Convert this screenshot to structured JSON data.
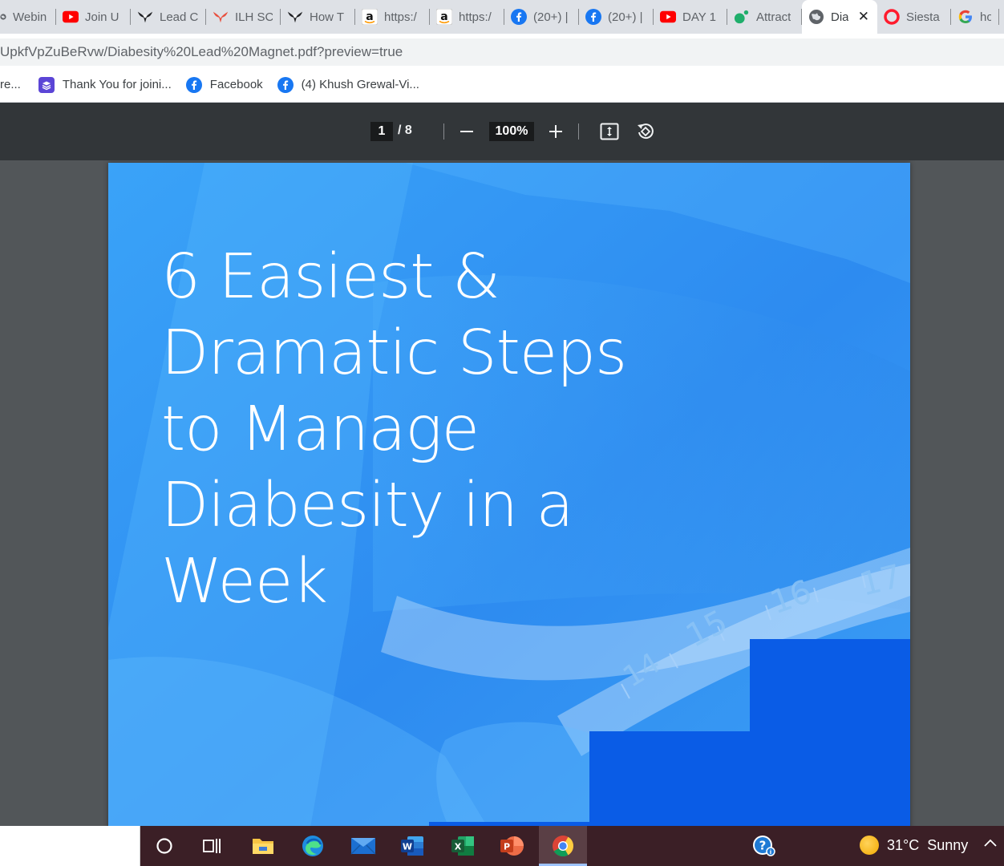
{
  "tabs": [
    {
      "title": "Webin",
      "icon": "globe-icon",
      "width": 70
    },
    {
      "title": "Join U",
      "icon": "youtube-icon",
      "width": 93
    },
    {
      "title": "Lead C",
      "icon": "eagle-icon",
      "width": 94
    },
    {
      "title": "ILH SC",
      "icon": "eagle-red-icon",
      "width": 93
    },
    {
      "title": "How T",
      "icon": "eagle-icon",
      "width": 93
    },
    {
      "title": "https:/",
      "icon": "amazon-icon",
      "width": 93
    },
    {
      "title": "https:/",
      "icon": "amazon-icon",
      "width": 93
    },
    {
      "title": "(20+) |",
      "icon": "facebook-icon",
      "width": 93
    },
    {
      "title": "(20+) |",
      "icon": "facebook-icon",
      "width": 93
    },
    {
      "title": "DAY 1",
      "icon": "youtube-icon",
      "width": 92
    },
    {
      "title": "Attract",
      "icon": "meet-icon",
      "width": 93
    },
    {
      "title": "Dia",
      "icon": "globe-icon",
      "width": 94,
      "active": true
    },
    {
      "title": "Siesta",
      "icon": "opera-icon",
      "width": 92
    },
    {
      "title": "how",
      "icon": "google-icon",
      "width": 60
    }
  ],
  "address": {
    "url": "UpkfVpZuBeRvw/Diabesity%20Lead%20Magnet.pdf?preview=true"
  },
  "bookmarks": [
    {
      "label": "re...",
      "icon": ""
    },
    {
      "label": "Thank You for joini...",
      "icon": "stack-icon"
    },
    {
      "label": "Facebook",
      "icon": "facebook-icon"
    },
    {
      "label": "(4) Khush Grewal-Vi...",
      "icon": "facebook-icon"
    }
  ],
  "pdf": {
    "current_page": "1",
    "page_separator": "/ 8",
    "zoom": "100%",
    "title_lines": [
      "6 Easiest &",
      "Dramatic Steps",
      "to Manage",
      "Diabesity in a",
      "Week"
    ],
    "tape_numbers": [
      "14",
      "15",
      "16",
      "17"
    ],
    "colors": {
      "page_bg": "#3fa4f7",
      "dark_block": "#0a5ce6"
    }
  },
  "taskbar": {
    "weather_temp": "31°C",
    "weather_text": "Sunny"
  }
}
